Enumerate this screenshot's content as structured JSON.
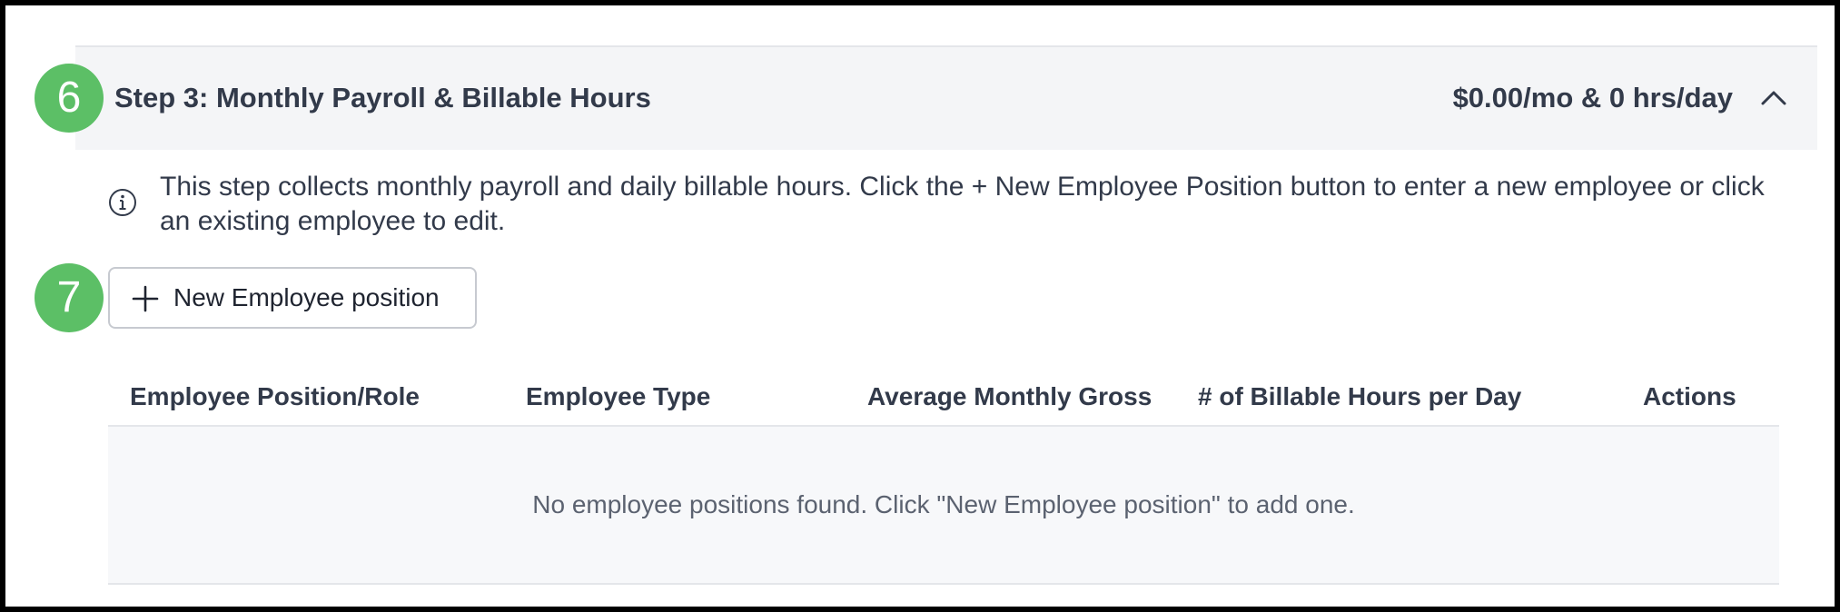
{
  "step": {
    "title": "Step 3: Monthly Payroll & Billable Hours",
    "summary": "$0.00/mo & 0 hrs/day",
    "toggle_icon": "chevron-up-icon"
  },
  "markers": {
    "step_marker": "6",
    "button_marker": "7",
    "color": "#5cbf66"
  },
  "info": {
    "icon": "info-icon",
    "text": "This step collects monthly payroll and daily billable hours. Click the + New Employee Position button to enter a new employee or click an existing employee to edit."
  },
  "toolbar": {
    "new_button_icon": "plus-icon",
    "new_button_label": "New Employee position"
  },
  "table": {
    "columns": [
      "Employee Position/Role",
      "Employee Type",
      "Average Monthly Gross",
      "# of Billable Hours per Day",
      "Actions"
    ],
    "rows": [],
    "empty_message": "No employee positions found. Click \"New Employee position\" to add one."
  }
}
